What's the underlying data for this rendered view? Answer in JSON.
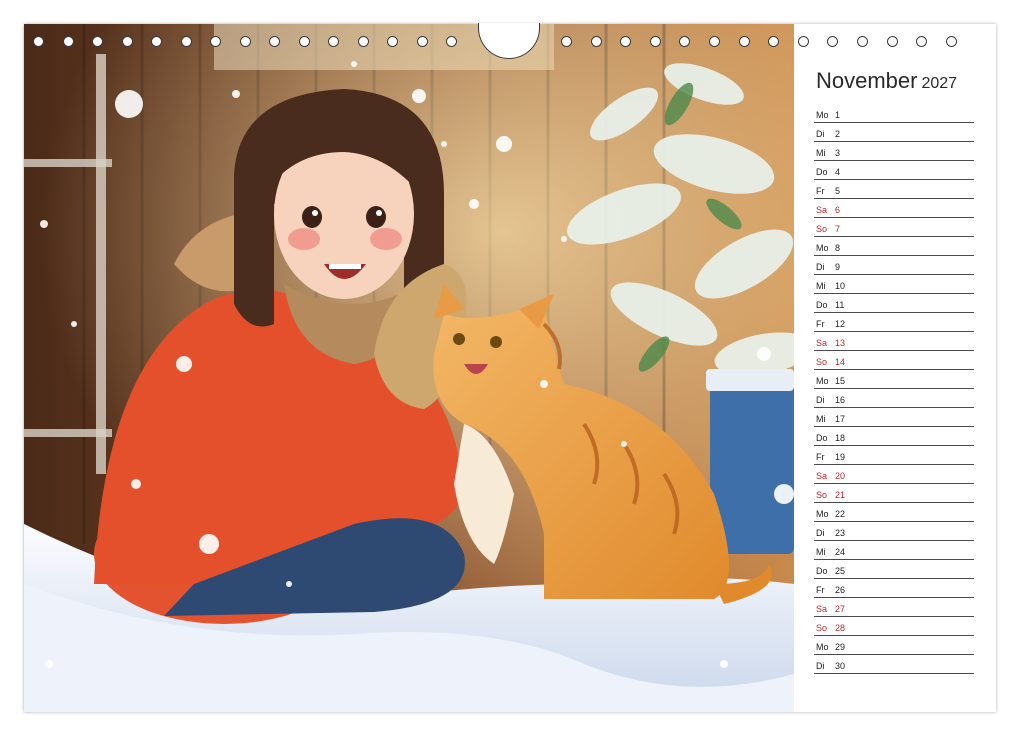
{
  "calendar": {
    "month": "November",
    "year": "2027",
    "colors": {
      "weekday": "#222222",
      "weekend": "#c0242b",
      "rule": "#4a4a4a"
    },
    "days": [
      {
        "day": "Mo",
        "num": "1",
        "weekend": false
      },
      {
        "day": "Di",
        "num": "2",
        "weekend": false
      },
      {
        "day": "Mi",
        "num": "3",
        "weekend": false
      },
      {
        "day": "Do",
        "num": "4",
        "weekend": false
      },
      {
        "day": "Fr",
        "num": "5",
        "weekend": false
      },
      {
        "day": "Sa",
        "num": "6",
        "weekend": true
      },
      {
        "day": "So",
        "num": "7",
        "weekend": true
      },
      {
        "day": "Mo",
        "num": "8",
        "weekend": false
      },
      {
        "day": "Di",
        "num": "9",
        "weekend": false
      },
      {
        "day": "Mi",
        "num": "10",
        "weekend": false
      },
      {
        "day": "Do",
        "num": "11",
        "weekend": false
      },
      {
        "day": "Fr",
        "num": "12",
        "weekend": false
      },
      {
        "day": "Sa",
        "num": "13",
        "weekend": true
      },
      {
        "day": "So",
        "num": "14",
        "weekend": true
      },
      {
        "day": "Mo",
        "num": "15",
        "weekend": false
      },
      {
        "day": "Di",
        "num": "16",
        "weekend": false
      },
      {
        "day": "Mi",
        "num": "17",
        "weekend": false
      },
      {
        "day": "Do",
        "num": "18",
        "weekend": false
      },
      {
        "day": "Fr",
        "num": "19",
        "weekend": false
      },
      {
        "day": "Sa",
        "num": "20",
        "weekend": true
      },
      {
        "day": "So",
        "num": "21",
        "weekend": true
      },
      {
        "day": "Mo",
        "num": "22",
        "weekend": false
      },
      {
        "day": "Di",
        "num": "23",
        "weekend": false
      },
      {
        "day": "Mi",
        "num": "24",
        "weekend": false
      },
      {
        "day": "Do",
        "num": "25",
        "weekend": false
      },
      {
        "day": "Fr",
        "num": "26",
        "weekend": false
      },
      {
        "day": "Sa",
        "num": "27",
        "weekend": true
      },
      {
        "day": "So",
        "num": "28",
        "weekend": true
      },
      {
        "day": "Mo",
        "num": "29",
        "weekend": false
      },
      {
        "day": "Di",
        "num": "30",
        "weekend": false
      }
    ]
  }
}
